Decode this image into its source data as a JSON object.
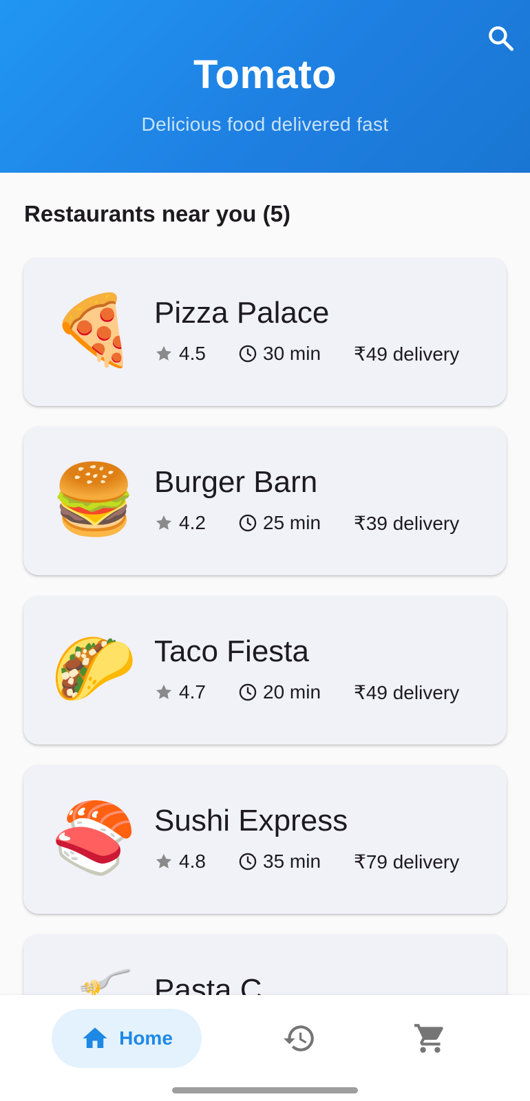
{
  "app": {
    "title": "Tomato",
    "subtitle": "Delicious food delivered fast",
    "search_icon": "search-icon"
  },
  "section": {
    "title": "Restaurants near you (5)"
  },
  "restaurants": [
    {
      "emoji": "🍕",
      "name": "Pizza Palace",
      "rating": "4.5",
      "time": "30 min",
      "delivery": "₹49 delivery"
    },
    {
      "emoji": "🍔",
      "name": "Burger Barn",
      "rating": "4.2",
      "time": "25 min",
      "delivery": "₹39 delivery"
    },
    {
      "emoji": "🌮",
      "name": "Taco Fiesta",
      "rating": "4.7",
      "time": "20 min",
      "delivery": "₹49 delivery"
    },
    {
      "emoji": "🍣",
      "name": "Sushi Express",
      "rating": "4.8",
      "time": "35 min",
      "delivery": "₹79 delivery"
    },
    {
      "emoji": "🍝",
      "name": "Pasta C"
    }
  ],
  "bottom_nav": {
    "home_label": "Home",
    "items": [
      "home-icon",
      "history-icon",
      "cart-icon"
    ]
  },
  "colors": {
    "header_primary": "#2196f3",
    "header_secondary": "#1976d2",
    "accent": "#1e88e5",
    "card_bg": "#f1f1f8",
    "nav_active_bg": "#e3f2fd",
    "muted_icon": "#757575"
  }
}
